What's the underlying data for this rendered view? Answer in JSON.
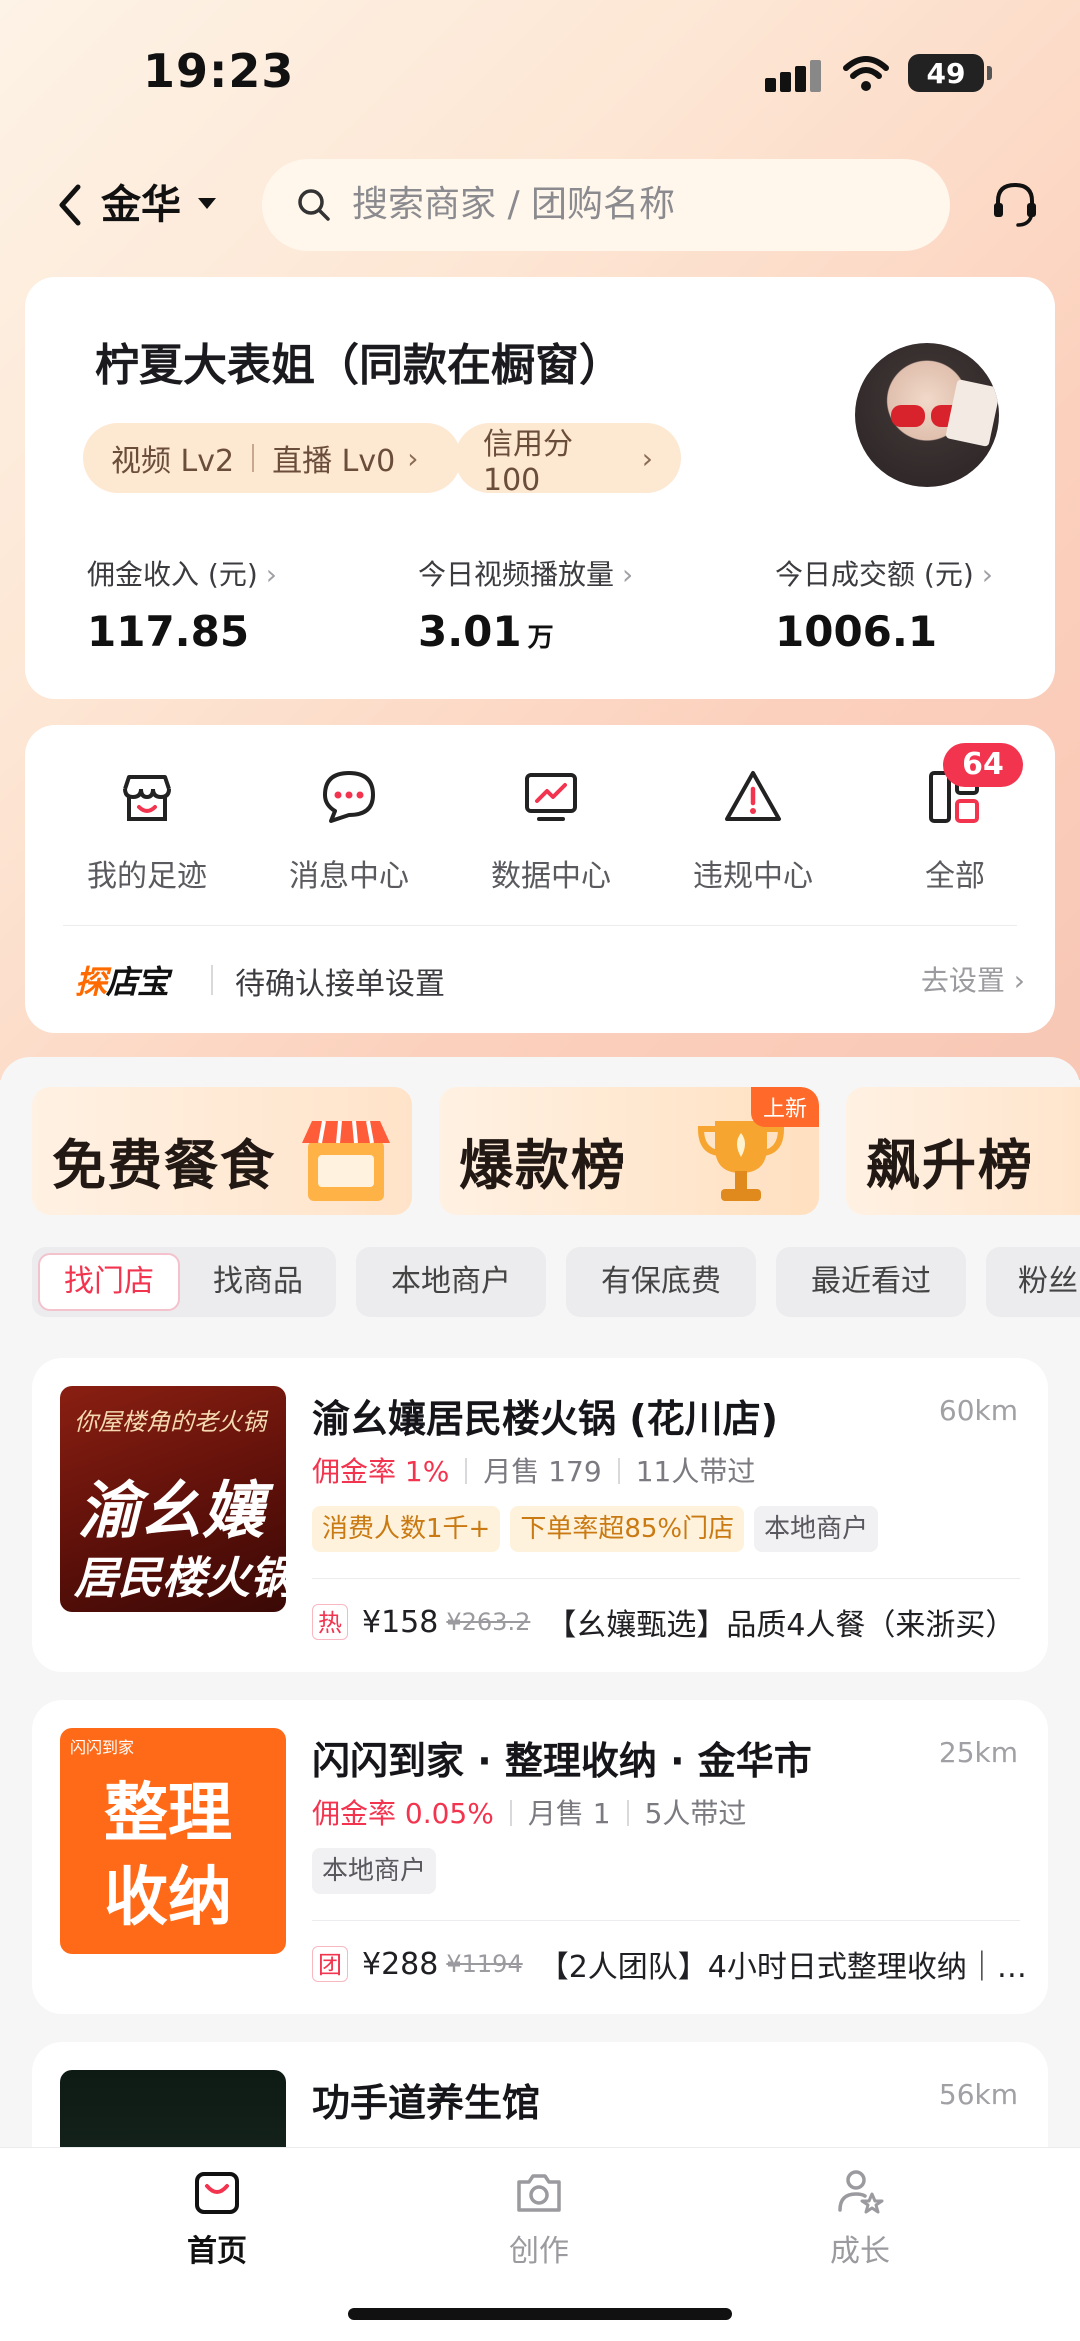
{
  "status_bar": {
    "time": "19:23",
    "battery": "49"
  },
  "header": {
    "city": "金华",
    "search_placeholder": "搜索商家 / 团购名称"
  },
  "profile": {
    "name": "柠夏大表姐（同款在橱窗）",
    "video_level": "视频 Lv2",
    "live_level": "直播 Lv0",
    "credit": "信用分100",
    "stats": [
      {
        "label": "佣金收入 (元)",
        "value": "117.85",
        "unit": ""
      },
      {
        "label": "今日视频播放量",
        "value": "3.01",
        "unit": "万"
      },
      {
        "label": "今日成交额 (元)",
        "value": "1006.1",
        "unit": ""
      }
    ]
  },
  "tools": {
    "items": [
      {
        "label": "我的足迹",
        "icon": "footprint-icon"
      },
      {
        "label": "消息中心",
        "icon": "message-icon"
      },
      {
        "label": "数据中心",
        "icon": "data-chart-icon"
      },
      {
        "label": "违规中心",
        "icon": "warning-icon"
      },
      {
        "label": "全部",
        "icon": "all-apps-icon"
      }
    ],
    "badge": "64",
    "footer_brand_1": "探",
    "footer_brand_2": "店宝",
    "footer_text": "待确认接单设置",
    "footer_link": "去设置"
  },
  "banners": [
    {
      "label": "免费餐食",
      "tag": ""
    },
    {
      "label": "爆款榜",
      "tag": "上新"
    },
    {
      "label": "飙升榜",
      "tag": ""
    }
  ],
  "filters": [
    "找门店",
    "找商品",
    "本地商户",
    "有保底费",
    "最近看过",
    "粉丝"
  ],
  "merchants": [
    {
      "title": "渝幺孃居民楼火锅 (花川店)",
      "distance": "60km",
      "commission": "佣金率 1%",
      "monthly": "月售 179",
      "carriers": "11人带过",
      "tags": [
        "消费人数1千+",
        "下单率超85%门店",
        "本地商户"
      ],
      "deal_badge": "热",
      "deal_price": "¥158",
      "deal_orig": "¥263.2",
      "deal_title": "【幺孃甄选】品质4人餐（来浙买）",
      "thumb_line1": "你屋楼角的老火锅",
      "thumb_line2": "渝幺孃",
      "thumb_line3": "居民楼火锅"
    },
    {
      "title": "闪闪到家 · 整理收纳 · 金华市",
      "distance": "25km",
      "commission": "佣金率 0.05%",
      "monthly": "月售 1",
      "carriers": "5人带过",
      "tags": [
        "本地商户"
      ],
      "deal_badge": "团",
      "deal_price": "¥288",
      "deal_orig": "¥1194",
      "deal_title": "【2人团队】4小时日式整理收纳｜…",
      "thumb_line0": "闪闪到家",
      "thumb_line1": "整理",
      "thumb_line2": "收纳"
    },
    {
      "title": "功手道养生馆",
      "distance": "56km"
    }
  ],
  "nav": [
    {
      "label": "首页",
      "icon": "home-bag-icon"
    },
    {
      "label": "创作",
      "icon": "camera-icon"
    },
    {
      "label": "成长",
      "icon": "growth-user-star-icon"
    }
  ]
}
